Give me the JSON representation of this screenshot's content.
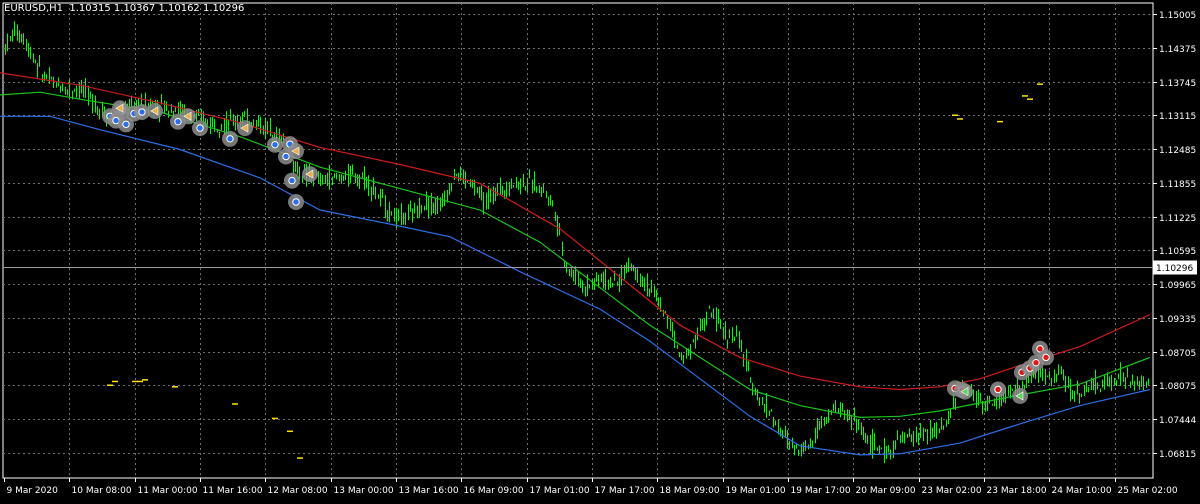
{
  "header": {
    "symbol": "EURUSD,H1",
    "ohlc": "1.10315 1.10367 1.10162 1.10296"
  },
  "colors": {
    "background": "#000000",
    "frame": "#ffffff",
    "grid": "#6e6e6e",
    "candles": "#00ff00",
    "ma_red": "#d11b1b",
    "ma_green": "#19c419",
    "ma_blue": "#2c6ee6",
    "price_line": "#9b9b9b",
    "marker_ring": "#8c8c8c",
    "signal_yellow": "#ffe400"
  },
  "chart_data": {
    "type": "candlestick",
    "x_ticks": [
      "9 Mar 2020",
      "10 Mar 08:00",
      "11 Mar 00:00",
      "11 Mar 16:00",
      "12 Mar 08:00",
      "13 Mar 00:00",
      "13 Mar 16:00",
      "16 Mar 09:00",
      "17 Mar 01:00",
      "17 Mar 17:00",
      "18 Mar 09:00",
      "19 Mar 01:00",
      "19 Mar 17:00",
      "20 Mar 09:00",
      "23 Mar 02:00",
      "23 Mar 18:00",
      "24 Mar 10:00",
      "25 Mar 02:00"
    ],
    "y_ticks": [
      1.15005,
      1.14375,
      1.13745,
      1.13115,
      1.12485,
      1.11855,
      1.11225,
      1.10595,
      1.09965,
      1.09335,
      1.08705,
      1.08075,
      1.07444,
      1.06815
    ],
    "ylim": [
      1.06348,
      1.15215
    ],
    "current_price": 1.10296,
    "current_price_label": "1.10296",
    "ma_red": [
      [
        0,
        1.1391
      ],
      [
        80,
        1.1368
      ],
      [
        160,
        1.1335
      ],
      [
        240,
        1.1298
      ],
      [
        320,
        1.1252
      ],
      [
        400,
        1.122
      ],
      [
        480,
        1.1185
      ],
      [
        560,
        1.11
      ],
      [
        620,
        1.101
      ],
      [
        680,
        1.092
      ],
      [
        740,
        1.086
      ],
      [
        800,
        1.0825
      ],
      [
        860,
        1.0805
      ],
      [
        900,
        1.08
      ],
      [
        940,
        1.0805
      ],
      [
        980,
        1.082
      ],
      [
        1020,
        1.0845
      ],
      [
        1080,
        1.088
      ],
      [
        1150,
        1.094
      ]
    ],
    "ma_green": [
      [
        0,
        1.135
      ],
      [
        40,
        1.1355
      ],
      [
        80,
        1.1342
      ],
      [
        160,
        1.1318
      ],
      [
        240,
        1.1272
      ],
      [
        320,
        1.1215
      ],
      [
        400,
        1.1175
      ],
      [
        480,
        1.1135
      ],
      [
        540,
        1.1075
      ],
      [
        600,
        1.099
      ],
      [
        650,
        1.092
      ],
      [
        700,
        1.086
      ],
      [
        750,
        1.08
      ],
      [
        800,
        1.077
      ],
      [
        860,
        1.0748
      ],
      [
        900,
        1.075
      ],
      [
        940,
        1.076
      ],
      [
        980,
        1.0775
      ],
      [
        1020,
        1.079
      ],
      [
        1080,
        1.081
      ],
      [
        1150,
        1.086
      ]
    ],
    "ma_blue": [
      [
        0,
        1.131
      ],
      [
        50,
        1.131
      ],
      [
        100,
        1.1285
      ],
      [
        180,
        1.1248
      ],
      [
        260,
        1.1195
      ],
      [
        320,
        1.1135
      ],
      [
        400,
        1.1105
      ],
      [
        450,
        1.1085
      ],
      [
        520,
        1.102
      ],
      [
        600,
        1.095
      ],
      [
        650,
        1.089
      ],
      [
        700,
        1.082
      ],
      [
        750,
        1.075
      ],
      [
        800,
        1.0695
      ],
      [
        860,
        1.0678
      ],
      [
        900,
        1.068
      ],
      [
        960,
        1.07
      ],
      [
        1010,
        1.073
      ],
      [
        1080,
        1.077
      ],
      [
        1150,
        1.08
      ]
    ],
    "price_path": [
      [
        5,
        1.144
      ],
      [
        14,
        1.1468
      ],
      [
        22,
        1.146
      ],
      [
        32,
        1.1425
      ],
      [
        42,
        1.1388
      ],
      [
        55,
        1.137
      ],
      [
        68,
        1.136
      ],
      [
        82,
        1.1362
      ],
      [
        96,
        1.133
      ],
      [
        108,
        1.131
      ],
      [
        118,
        1.1315
      ],
      [
        132,
        1.133
      ],
      [
        150,
        1.1335
      ],
      [
        165,
        1.1328
      ],
      [
        180,
        1.1322
      ],
      [
        195,
        1.1305
      ],
      [
        210,
        1.13
      ],
      [
        225,
        1.1295
      ],
      [
        240,
        1.1305
      ],
      [
        255,
        1.1298
      ],
      [
        270,
        1.1285
      ],
      [
        285,
        1.1262
      ],
      [
        295,
        1.121
      ],
      [
        305,
        1.12
      ],
      [
        320,
        1.119
      ],
      [
        335,
        1.1195
      ],
      [
        350,
        1.12
      ],
      [
        365,
        1.1195
      ],
      [
        380,
        1.1155
      ],
      [
        395,
        1.112
      ],
      [
        410,
        1.1125
      ],
      [
        425,
        1.115
      ],
      [
        440,
        1.114
      ],
      [
        455,
        1.1205
      ],
      [
        470,
        1.1185
      ],
      [
        485,
        1.115
      ],
      [
        500,
        1.1175
      ],
      [
        515,
        1.1185
      ],
      [
        530,
        1.1185
      ],
      [
        545,
        1.1172
      ],
      [
        555,
        1.1135
      ],
      [
        565,
        1.103
      ],
      [
        575,
        1.101
      ],
      [
        585,
        1.099
      ],
      [
        600,
        1.101
      ],
      [
        615,
        1.0995
      ],
      [
        630,
        1.1035
      ],
      [
        645,
        1.1
      ],
      [
        660,
        1.096
      ],
      [
        672,
        1.091
      ],
      [
        682,
        1.085
      ],
      [
        695,
        1.09
      ],
      [
        710,
        1.0945
      ],
      [
        725,
        1.0905
      ],
      [
        738,
        1.0895
      ],
      [
        750,
        1.082
      ],
      [
        760,
        1.078
      ],
      [
        770,
        1.076
      ],
      [
        780,
        1.072
      ],
      [
        795,
        1.069
      ],
      [
        810,
        1.07
      ],
      [
        825,
        1.0755
      ],
      [
        840,
        1.0765
      ],
      [
        855,
        1.074
      ],
      [
        870,
        1.07
      ],
      [
        885,
        1.068
      ],
      [
        900,
        1.0705
      ],
      [
        915,
        1.0715
      ],
      [
        930,
        1.072
      ],
      [
        945,
        1.073
      ],
      [
        958,
        1.0805
      ],
      [
        975,
        1.079
      ],
      [
        990,
        1.077
      ],
      [
        1005,
        1.079
      ],
      [
        1020,
        1.08
      ],
      [
        1035,
        1.0835
      ],
      [
        1050,
        1.082
      ],
      [
        1060,
        1.083
      ],
      [
        1075,
        1.079
      ],
      [
        1090,
        1.0805
      ],
      [
        1105,
        1.081
      ],
      [
        1120,
        1.0825
      ],
      [
        1135,
        1.081
      ],
      [
        1150,
        1.0812
      ]
    ],
    "buy_markers": [
      [
        110,
        1.131
      ],
      [
        122,
        1.132
      ],
      [
        134,
        1.1315
      ],
      [
        116,
        1.1302
      ],
      [
        126,
        1.1295
      ],
      [
        142,
        1.1318
      ],
      [
        178,
        1.13
      ],
      [
        200,
        1.1288
      ],
      [
        230,
        1.1268
      ],
      [
        275,
        1.1257
      ],
      [
        290,
        1.1258
      ],
      [
        286,
        1.1235
      ],
      [
        292,
        1.119
      ],
      [
        296,
        1.115
      ]
    ],
    "buy_exit_markers": [
      [
        120,
        1.1325
      ],
      [
        155,
        1.132
      ],
      [
        188,
        1.131
      ],
      [
        245,
        1.1288
      ],
      [
        296,
        1.1245
      ],
      [
        310,
        1.1202
      ]
    ],
    "sell_markers": [
      [
        955,
        1.0802
      ],
      [
        962,
        1.0799
      ],
      [
        998,
        1.08
      ],
      [
        1022,
        1.0832
      ],
      [
        1030,
        1.084
      ],
      [
        1036,
        1.085
      ],
      [
        1040,
        1.0876
      ],
      [
        1046,
        1.086
      ]
    ],
    "sell_exit_markers": [
      [
        1020,
        1.0788
      ],
      [
        965,
        1.0796
      ]
    ],
    "signal_dashes": [
      [
        115,
        1.0815
      ],
      [
        135,
        1.0815
      ],
      [
        140,
        1.0815
      ],
      [
        145,
        1.0818
      ],
      [
        110,
        1.0808
      ],
      [
        175,
        1.0805
      ],
      [
        235,
        1.0773
      ],
      [
        275,
        1.0746
      ],
      [
        290,
        1.0722
      ],
      [
        300,
        1.0672
      ],
      [
        955,
        1.1312
      ],
      [
        960,
        1.1305
      ],
      [
        1000,
        1.13
      ],
      [
        1025,
        1.1348
      ],
      [
        1030,
        1.1342
      ],
      [
        1040,
        1.137
      ]
    ]
  }
}
